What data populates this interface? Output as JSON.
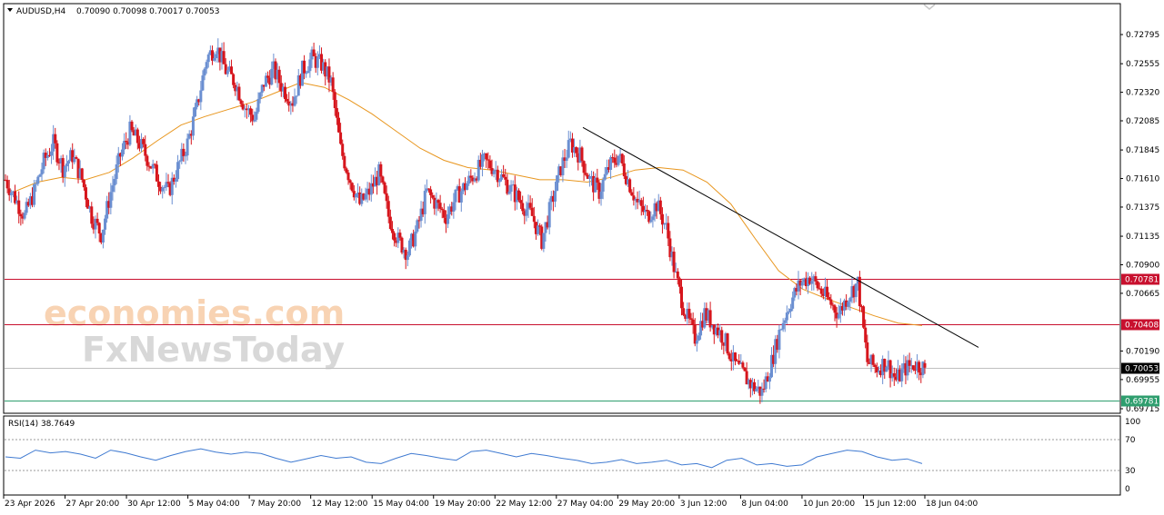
{
  "header": {
    "symbol": "AUDUSD,H4",
    "ohlc": "0.70090 0.70098 0.70017 0.70053"
  },
  "watermark": {
    "brand1": "economies.com",
    "brand2": "FxNewsToday"
  },
  "colors": {
    "bull": "#6b8fd1",
    "bear": "#d6151c",
    "ma": "#e8961e",
    "resistance": "#c8102e",
    "support": "#2e9e6e",
    "rsi": "#3f7ad1",
    "trendline": "#000000"
  },
  "price_axis_ticks": [
    "0.72795",
    "0.72555",
    "0.72320",
    "0.72085",
    "0.71845",
    "0.71610",
    "0.71375",
    "0.71135",
    "0.70900",
    "0.70665",
    "0.70190",
    "0.69955",
    "0.69715"
  ],
  "levels": [
    {
      "label": "0.70781",
      "kind": "resistance"
    },
    {
      "label": "0.70408",
      "kind": "resistance"
    },
    {
      "label": "0.70053",
      "kind": "current"
    },
    {
      "label": "0.69781",
      "kind": "support"
    }
  ],
  "rsi": {
    "label": "RSI(14) 38.7649",
    "ticks": [
      "100",
      "70",
      "30",
      "0"
    ]
  },
  "time_labels": [
    "23 Apr 2026",
    "27 Apr 20:00",
    "30 Apr 12:00",
    "5 May 04:00",
    "7 May 20:00",
    "12 May 12:00",
    "15 May 04:00",
    "19 May 20:00",
    "22 May 12:00",
    "27 May 04:00",
    "29 May 20:00",
    "3 Jun 12:00",
    "8 Jun 04:00",
    "10 Jun 20:00",
    "15 Jun 12:00",
    "18 Jun 04:00"
  ],
  "chart_data": {
    "type": "candlestick",
    "title": "AUDUSD,H4",
    "symbol": "AUDUSD",
    "timeframe": "H4",
    "ylim": [
      0.697,
      0.729
    ],
    "x_range": [
      "23 Apr 2026",
      "18 Jun 04:00"
    ],
    "last_ohlc": {
      "open": 0.7009,
      "high": 0.70098,
      "low": 0.70017,
      "close": 0.70053
    },
    "close_path": [
      0.716,
      0.7145,
      0.713,
      0.715,
      0.7175,
      0.719,
      0.717,
      0.718,
      0.716,
      0.713,
      0.7115,
      0.715,
      0.718,
      0.72,
      0.719,
      0.7175,
      0.716,
      0.715,
      0.717,
      0.719,
      0.722,
      0.726,
      0.727,
      0.725,
      0.724,
      0.722,
      0.721,
      0.724,
      0.725,
      0.7235,
      0.7225,
      0.725,
      0.726,
      0.7255,
      0.724,
      0.7185,
      0.716,
      0.714,
      0.715,
      0.7165,
      0.713,
      0.711,
      0.71,
      0.712,
      0.715,
      0.714,
      0.713,
      0.7145,
      0.7155,
      0.7165,
      0.7175,
      0.717,
      0.716,
      0.715,
      0.714,
      0.713,
      0.711,
      0.714,
      0.717,
      0.719,
      0.718,
      0.716,
      0.715,
      0.717,
      0.718,
      0.716,
      0.714,
      0.713,
      0.714,
      0.712,
      0.708,
      0.705,
      0.703,
      0.705,
      0.704,
      0.703,
      0.701,
      0.7,
      0.699,
      0.6985,
      0.701,
      0.704,
      0.706,
      0.7075,
      0.708,
      0.707,
      0.706,
      0.705,
      0.7065,
      0.7075,
      0.701,
      0.7005,
      0.701,
      0.6995,
      0.7005,
      0.7008,
      0.70053
    ],
    "ma_path": [
      0.715,
      0.7158,
      0.7162,
      0.716,
      0.7166,
      0.7178,
      0.7192,
      0.7205,
      0.7212,
      0.7218,
      0.7224,
      0.7232,
      0.724,
      0.7236,
      0.7226,
      0.7214,
      0.72,
      0.7186,
      0.7176,
      0.717,
      0.7168,
      0.7164,
      0.716,
      0.716,
      0.7158,
      0.7162,
      0.7168,
      0.717,
      0.7168,
      0.7158,
      0.714,
      0.7112,
      0.7085,
      0.707,
      0.7062,
      0.7055,
      0.7048,
      0.7042,
      0.704
    ],
    "levels": {
      "resistance": [
        0.70781,
        0.70408
      ],
      "support": [
        0.69781
      ],
      "current": 0.70053
    },
    "trendline": {
      "from": {
        "time": "29 May 04:00",
        "price": 0.7203
      },
      "to": {
        "time": "20 Jun",
        "price": 0.7022
      }
    },
    "rsi": {
      "period": 14,
      "value": 38.7649,
      "overbought": 70,
      "oversold": 30,
      "values": [
        50,
        48,
        60,
        56,
        58,
        54,
        48,
        60,
        56,
        50,
        45,
        52,
        58,
        62,
        57,
        54,
        57,
        55,
        48,
        42,
        47,
        52,
        48,
        50,
        42,
        40,
        48,
        55,
        52,
        48,
        45,
        58,
        60,
        55,
        50,
        55,
        52,
        48,
        45,
        40,
        42,
        46,
        40,
        42,
        45,
        38,
        40,
        34,
        45,
        48,
        38,
        40,
        36,
        38,
        50,
        55,
        60,
        58,
        50,
        45,
        47,
        40
      ]
    }
  }
}
